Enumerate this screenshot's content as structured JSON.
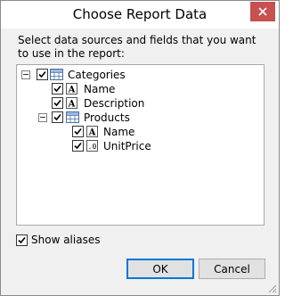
{
  "window": {
    "title": "Choose Report Data",
    "close_icon": "close-icon"
  },
  "description": "Select data sources and fields that you want to use in the report:",
  "tree": {
    "nodes": [
      {
        "label": "Categories",
        "icon": "table-icon",
        "checked": true,
        "expandable": true,
        "expanded": true
      },
      {
        "label": "Name",
        "icon": "text-field-icon",
        "checked": true
      },
      {
        "label": "Description",
        "icon": "text-field-icon",
        "checked": true
      },
      {
        "label": "Products",
        "icon": "table-icon",
        "checked": true,
        "expandable": true,
        "expanded": true
      },
      {
        "label": "Name",
        "icon": "text-field-icon",
        "checked": true
      },
      {
        "label": "UnitPrice",
        "icon": "numeric-field-icon",
        "checked": true
      }
    ]
  },
  "show_aliases": {
    "label": "Show aliases",
    "checked": true
  },
  "buttons": {
    "ok": "OK",
    "cancel": "Cancel"
  },
  "colors": {
    "close": "#c75050",
    "accent": "#0078d7",
    "dialog_bg": "#f0f0f0"
  }
}
